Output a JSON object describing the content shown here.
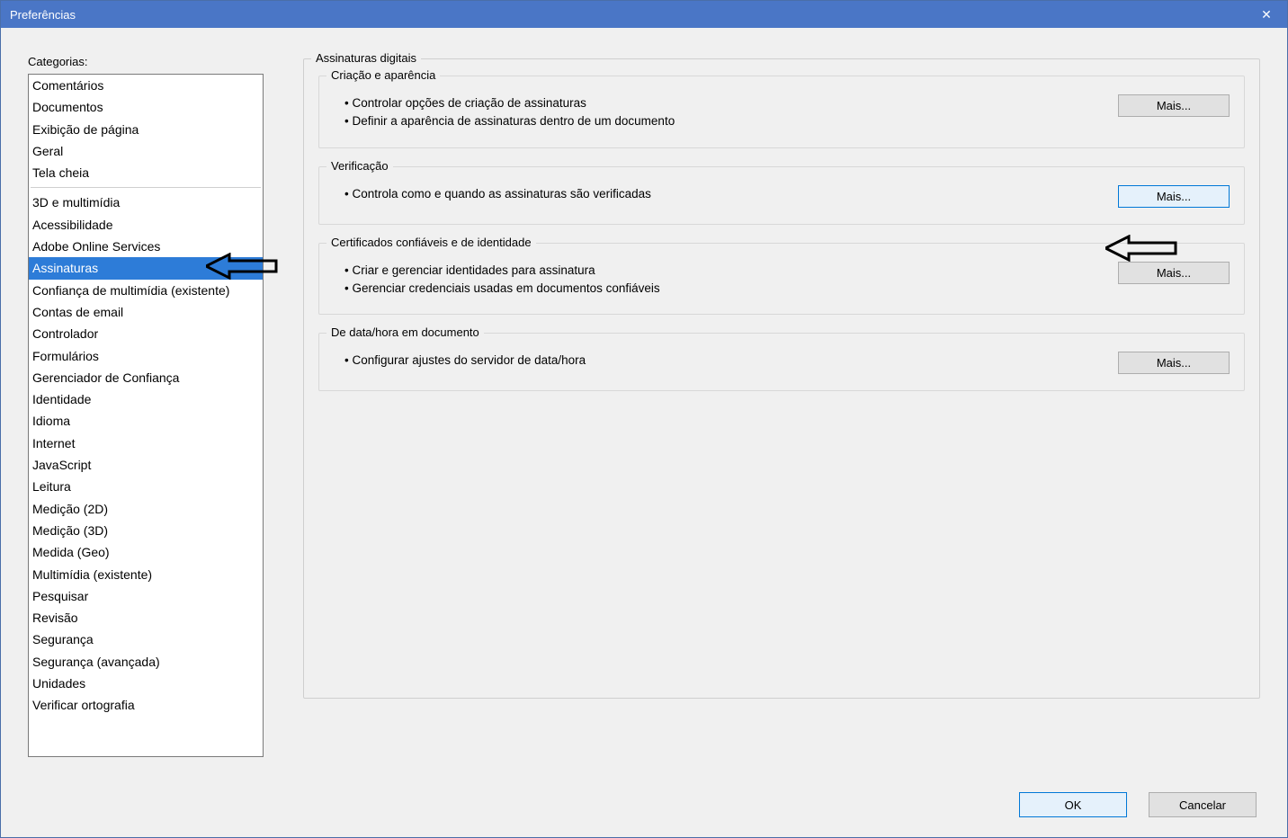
{
  "window": {
    "title": "Preferências"
  },
  "sidebar": {
    "label": "Categorias:",
    "group1": [
      "Comentários",
      "Documentos",
      "Exibição de página",
      "Geral",
      "Tela cheia"
    ],
    "group2": [
      "3D e multimídia",
      "Acessibilidade",
      "Adobe Online Services",
      "Assinaturas",
      "Confiança de multimídia (existente)",
      "Contas de email",
      "Controlador",
      "Formulários",
      "Gerenciador de Confiança",
      "Identidade",
      "Idioma",
      "Internet",
      "JavaScript",
      "Leitura",
      "Medição (2D)",
      "Medição (3D)",
      "Medida (Geo)",
      "Multimídia (existente)",
      "Pesquisar",
      "Revisão",
      "Segurança",
      "Segurança (avançada)",
      "Unidades",
      "Verificar ortografia"
    ],
    "selected": "Assinaturas"
  },
  "panel": {
    "title": "Assinaturas digitais",
    "sections": [
      {
        "title": "Criação e aparência",
        "bullets": [
          "Controlar opções de criação de assinaturas",
          "Definir a aparência de assinaturas dentro de um documento"
        ],
        "button": "Mais..."
      },
      {
        "title": "Verificação",
        "bullets": [
          "Controla como e quando as assinaturas são verificadas"
        ],
        "button": "Mais..."
      },
      {
        "title": "Certificados confiáveis e de identidade",
        "bullets": [
          "Criar e gerenciar identidades para assinatura",
          "Gerenciar credenciais usadas em documentos confiáveis"
        ],
        "button": "Mais..."
      },
      {
        "title": "De data/hora em documento",
        "bullets": [
          "Configurar ajustes do servidor de data/hora"
        ],
        "button": "Mais..."
      }
    ]
  },
  "buttons": {
    "ok": "OK",
    "cancel": "Cancelar"
  }
}
